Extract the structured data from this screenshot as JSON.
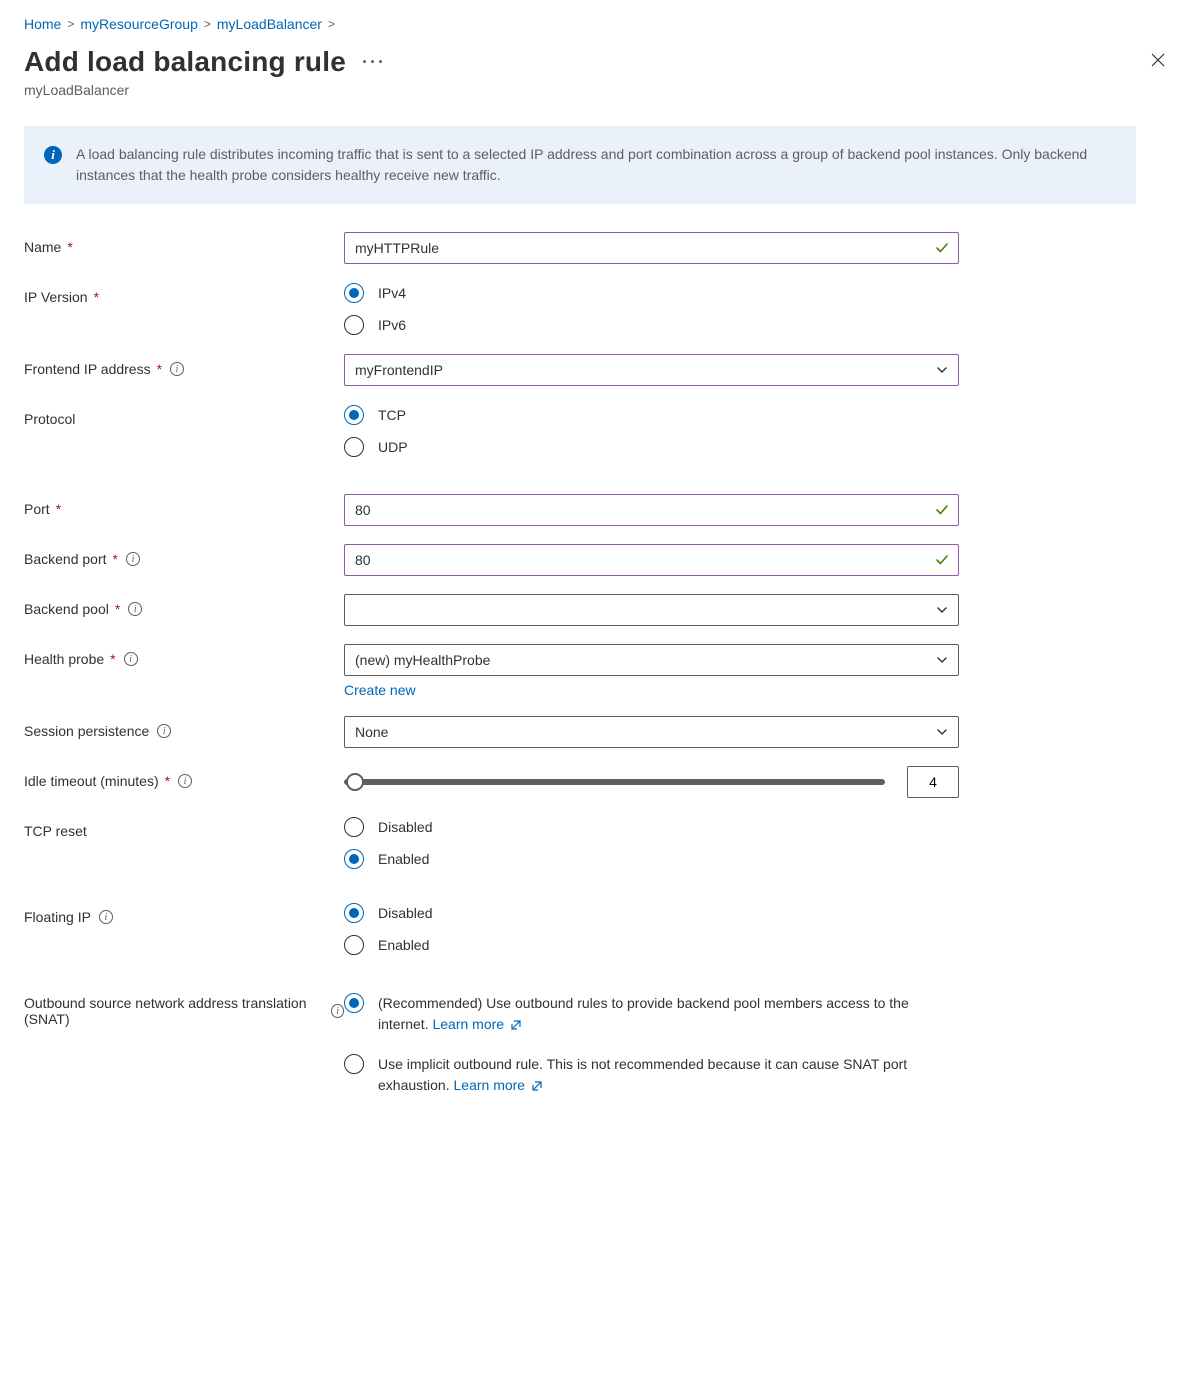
{
  "breadcrumb": [
    {
      "label": "Home"
    },
    {
      "label": "myResourceGroup"
    },
    {
      "label": "myLoadBalancer"
    }
  ],
  "header": {
    "title": "Add load balancing rule",
    "subtitle": "myLoadBalancer"
  },
  "info": {
    "text": "A load balancing rule distributes incoming traffic that is sent to a selected IP address and port combination across a group of backend pool instances. Only backend instances that the health probe considers healthy receive new traffic."
  },
  "form": {
    "name": {
      "label": "Name",
      "value": "myHTTPRule",
      "valid": true
    },
    "ipVersion": {
      "label": "IP Version",
      "options": [
        "IPv4",
        "IPv6"
      ],
      "selected": "IPv4"
    },
    "frontendIp": {
      "label": "Frontend IP address",
      "value": "myFrontendIP"
    },
    "protocol": {
      "label": "Protocol",
      "options": [
        "TCP",
        "UDP"
      ],
      "selected": "TCP"
    },
    "port": {
      "label": "Port",
      "value": "80",
      "valid": true
    },
    "backendPort": {
      "label": "Backend port",
      "value": "80",
      "valid": true
    },
    "backendPool": {
      "label": "Backend pool",
      "value": ""
    },
    "healthProbe": {
      "label": "Health probe",
      "value": "(new) myHealthProbe",
      "createNew": "Create new"
    },
    "sessionPersistence": {
      "label": "Session persistence",
      "value": "None"
    },
    "idleTimeout": {
      "label": "Idle timeout (minutes)",
      "value": "4"
    },
    "tcpReset": {
      "label": "TCP reset",
      "options": [
        "Disabled",
        "Enabled"
      ],
      "selected": "Enabled"
    },
    "floatingIp": {
      "label": "Floating IP",
      "options": [
        "Disabled",
        "Enabled"
      ],
      "selected": "Disabled"
    },
    "snat": {
      "label": "Outbound source network address translation (SNAT)",
      "options": [
        {
          "text": "(Recommended) Use outbound rules to provide backend pool members access to the internet.",
          "learn": "Learn more"
        },
        {
          "text": "Use implicit outbound rule. This is not recommended because it can cause SNAT port exhaustion.",
          "learn": "Learn more"
        }
      ],
      "selectedIndex": 0
    }
  }
}
